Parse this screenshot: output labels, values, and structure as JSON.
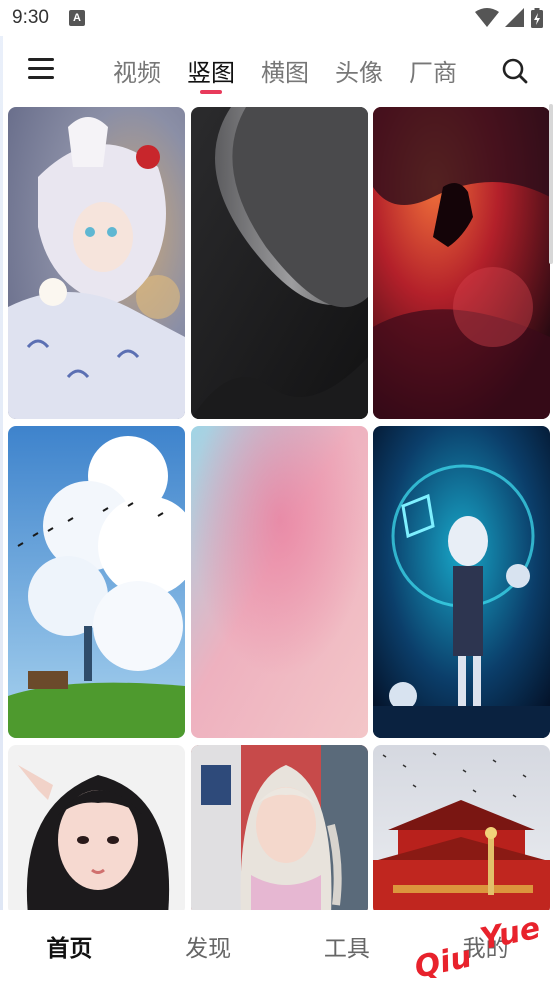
{
  "status_bar": {
    "time": "9:30",
    "notification_glyph": "A",
    "icons": [
      "wifi-icon",
      "signal-icon",
      "battery-charging-icon"
    ]
  },
  "header": {
    "tabs": [
      {
        "label": "视频",
        "active": false
      },
      {
        "label": "竖图",
        "active": true
      },
      {
        "label": "横图",
        "active": false
      },
      {
        "label": "头像",
        "active": false
      },
      {
        "label": "厂商",
        "active": false
      }
    ],
    "accent_color": "#e83a5b",
    "icons": [
      "menu-icon",
      "search-icon"
    ]
  },
  "wallpapers": [
    {
      "name": "wallpaper-anime-girl-fox-mask",
      "row": 1,
      "col": 1
    },
    {
      "name": "wallpaper-black-silk-wave",
      "row": 1,
      "col": 2
    },
    {
      "name": "wallpaper-red-nebula",
      "row": 1,
      "col": 3
    },
    {
      "name": "wallpaper-anime-sky-clouds",
      "row": 2,
      "col": 1
    },
    {
      "name": "wallpaper-pink-blue-gradient",
      "row": 2,
      "col": 2
    },
    {
      "name": "wallpaper-anime-cyber-girl",
      "row": 2,
      "col": 3
    },
    {
      "name": "wallpaper-girl-portrait-dark-hair",
      "row": 3,
      "col": 1
    },
    {
      "name": "wallpaper-girl-portrait-blonde",
      "row": 3,
      "col": 2
    },
    {
      "name": "wallpaper-tiananmen-gate",
      "row": 3,
      "col": 3
    }
  ],
  "bottom_nav": [
    {
      "label": "首页",
      "active": true
    },
    {
      "label": "发现",
      "active": false
    },
    {
      "label": "工具",
      "active": false
    },
    {
      "label": "我的",
      "active": false
    }
  ],
  "watermark": {
    "text_1": "Qiu",
    "text_2": "Yue",
    "color": "#e8222c"
  }
}
